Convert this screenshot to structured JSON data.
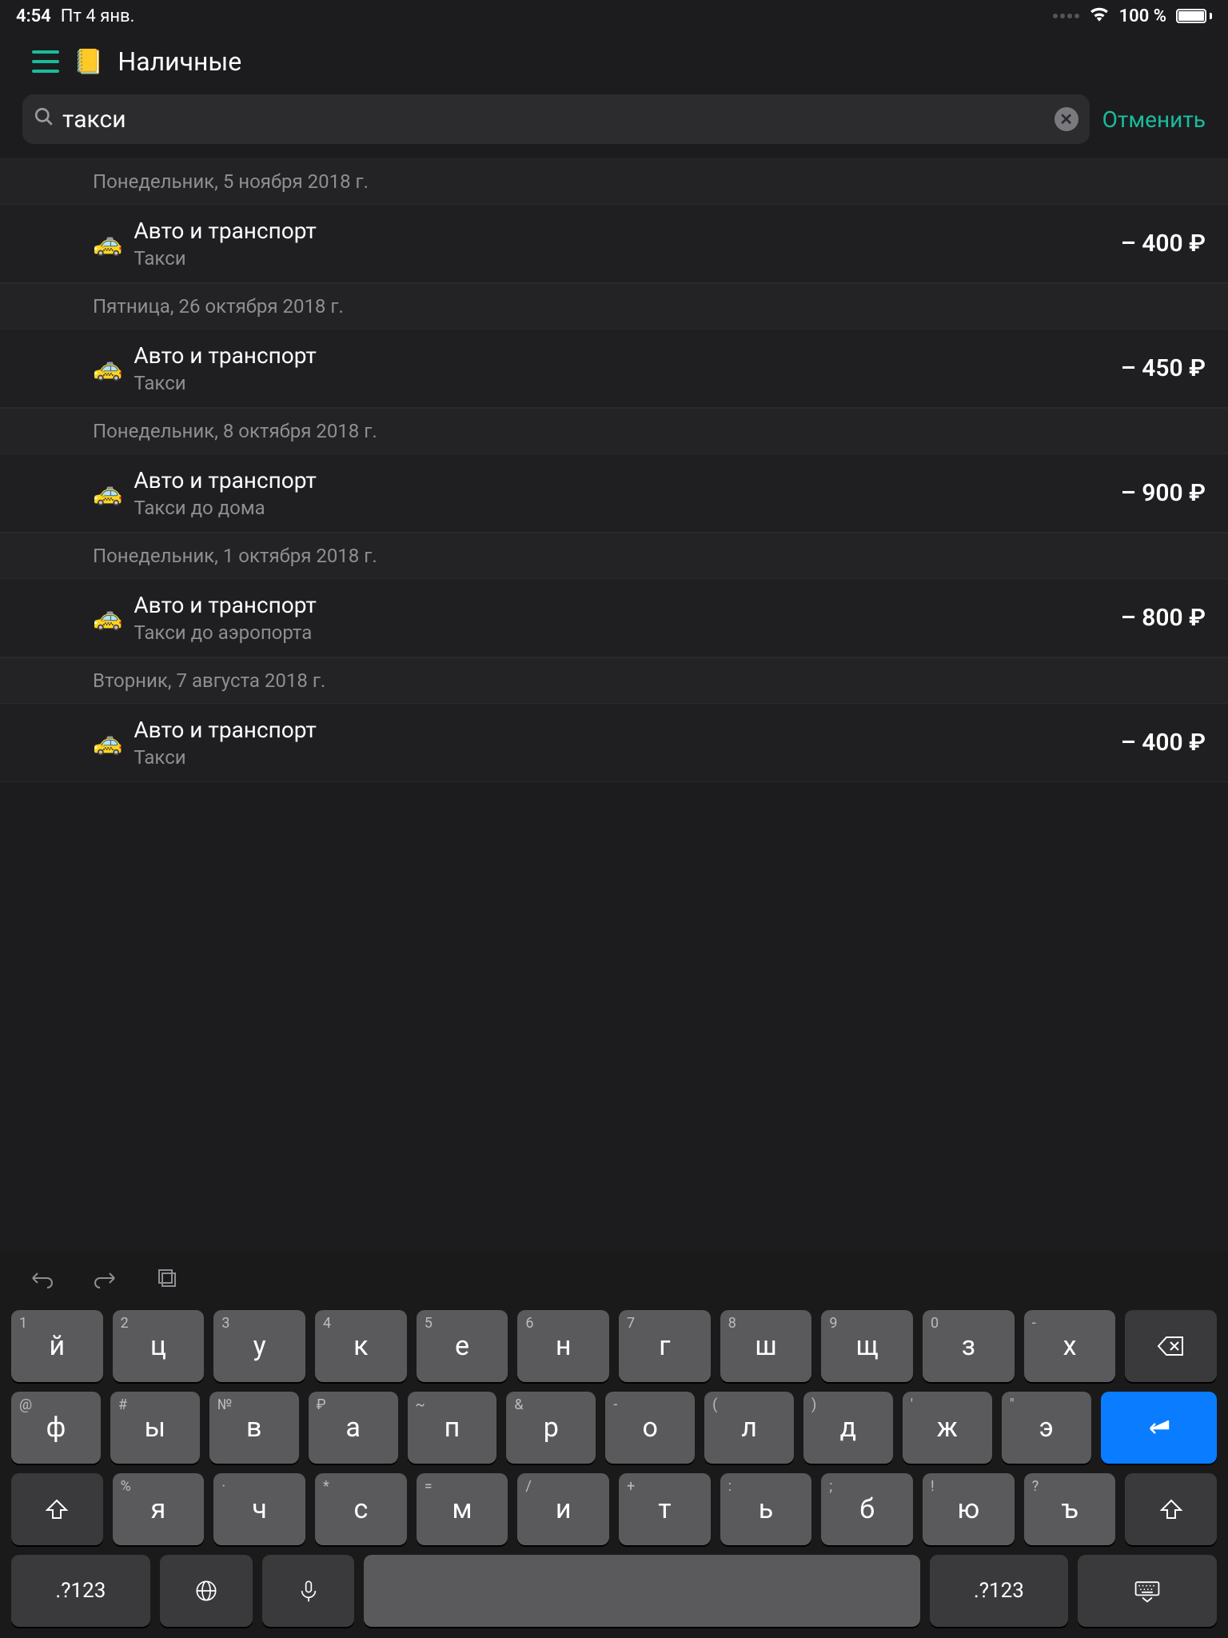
{
  "status": {
    "time": "4:54",
    "date": "Пт 4 янв.",
    "battery_pct": "100 %"
  },
  "header": {
    "title": "Наличные",
    "wallet_icon": "wallet"
  },
  "search": {
    "value": "такси",
    "cancel_label": "Отменить"
  },
  "currency_symbol": "₽",
  "transactions": [
    {
      "date": "Понедельник, 5 ноября 2018 г.",
      "icon": "🚕",
      "category": "Авто и транспорт",
      "note": "Такси",
      "amount": "– 400 ₽"
    },
    {
      "date": "Пятница, 26 октября 2018 г.",
      "icon": "🚕",
      "category": "Авто и транспорт",
      "note": "Такси",
      "amount": "– 450 ₽"
    },
    {
      "date": "Понедельник, 8 октября 2018 г.",
      "icon": "🚕",
      "category": "Авто и транспорт",
      "note": "Такси до дома",
      "amount": "– 900 ₽"
    },
    {
      "date": "Понедельник, 1 октября 2018 г.",
      "icon": "🚕",
      "category": "Авто и транспорт",
      "note": "Такси до аэропорта",
      "amount": "– 800 ₽"
    },
    {
      "date": "Вторник, 7 августа 2018 г.",
      "icon": "🚕",
      "category": "Авто и транспорт",
      "note": "Такси",
      "amount": "– 400 ₽"
    }
  ],
  "keyboard": {
    "row1": [
      {
        "main": "й",
        "sup": "1"
      },
      {
        "main": "ц",
        "sup": "2"
      },
      {
        "main": "у",
        "sup": "3"
      },
      {
        "main": "к",
        "sup": "4"
      },
      {
        "main": "е",
        "sup": "5"
      },
      {
        "main": "н",
        "sup": "6"
      },
      {
        "main": "г",
        "sup": "7"
      },
      {
        "main": "ш",
        "sup": "8"
      },
      {
        "main": "щ",
        "sup": "9"
      },
      {
        "main": "з",
        "sup": "0"
      },
      {
        "main": "х",
        "sup": "-"
      }
    ],
    "row2": [
      {
        "main": "ф",
        "sup": "@"
      },
      {
        "main": "ы",
        "sup": "#"
      },
      {
        "main": "в",
        "sup": "№"
      },
      {
        "main": "а",
        "sup": "₽"
      },
      {
        "main": "п",
        "sup": "~"
      },
      {
        "main": "р",
        "sup": "&"
      },
      {
        "main": "о",
        "sup": "-"
      },
      {
        "main": "л",
        "sup": "("
      },
      {
        "main": "д",
        "sup": ")"
      },
      {
        "main": "ж",
        "sup": "'"
      },
      {
        "main": "э",
        "sup": "\""
      }
    ],
    "row3": [
      {
        "main": "я",
        "sup": "%"
      },
      {
        "main": "ч",
        "sup": "·"
      },
      {
        "main": "с",
        "sup": "*"
      },
      {
        "main": "м",
        "sup": "="
      },
      {
        "main": "и",
        "sup": "/"
      },
      {
        "main": "т",
        "sup": "+"
      },
      {
        "main": "ь",
        "sup": ":"
      },
      {
        "main": "б",
        "sup": ";"
      },
      {
        "main": "ю",
        "sup": "!"
      },
      {
        "main": "ъ",
        "sup": "?"
      }
    ],
    "numkey": ".?123"
  }
}
